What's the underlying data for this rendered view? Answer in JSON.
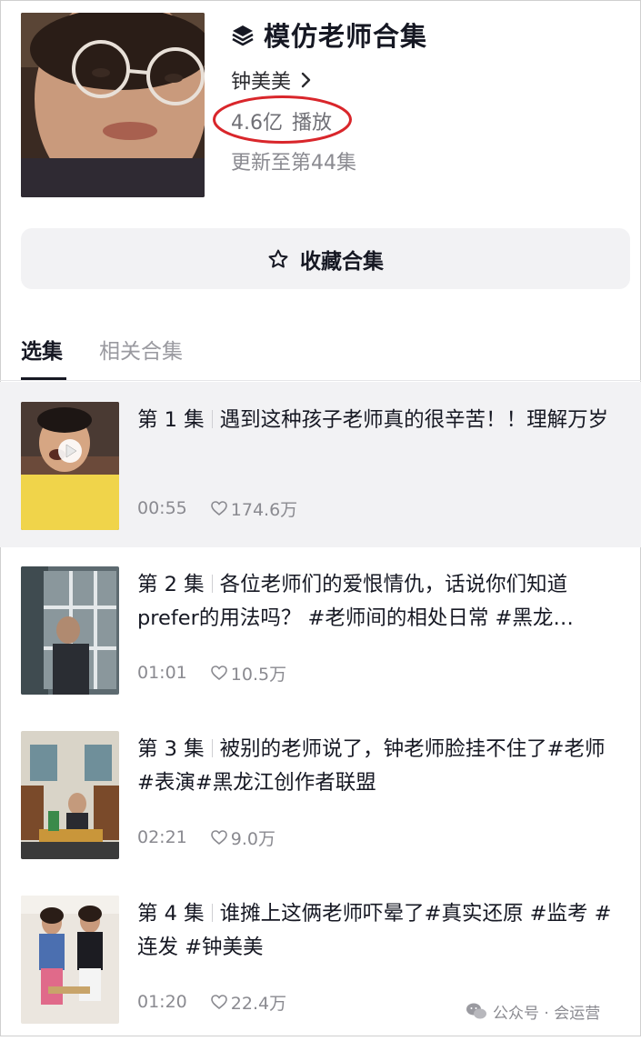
{
  "collection": {
    "title": "模仿老师合集",
    "author": "钟美美",
    "plays_value": "4.6亿",
    "plays_label": "播放",
    "update_text": "更新至第44集",
    "favorite_label": "收藏合集"
  },
  "tabs": [
    {
      "label": "选集",
      "active": true
    },
    {
      "label": "相关合集",
      "active": false
    }
  ],
  "episodes": [
    {
      "number": "第 1 集",
      "title": "遇到这种孩子老师真的很辛苦！！理解万岁",
      "duration": "00:55",
      "likes": "174.6万",
      "current": true
    },
    {
      "number": "第 2 集",
      "title": "各位老师们的爱恨情仇，话说你们知道prefer的用法吗？  #老师间的相处日常 #黑龙…",
      "duration": "01:01",
      "likes": "10.5万",
      "current": false
    },
    {
      "number": "第 3 集",
      "title": "被别的老师说了，钟老师脸挂不住了#老师 #表演#黑龙江创作者联盟",
      "duration": "02:21",
      "likes": "9.0万",
      "current": false
    },
    {
      "number": "第 4 集",
      "title": "谁摊上这俩老师吓晕了#真实还原 #监考 #连发 #钟美美",
      "duration": "01:20",
      "likes": "22.4万",
      "current": false
    }
  ],
  "watermark": "公众号 · 会运营",
  "colors": {
    "highlight_ring": "#d9262b",
    "text_primary": "#161823",
    "text_secondary": "#8a8a90",
    "button_bg": "#f2f2f4"
  }
}
